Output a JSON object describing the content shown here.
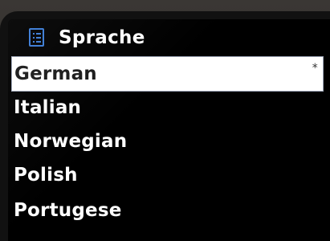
{
  "header": {
    "icon": "list-menu-icon",
    "title": "Sprache"
  },
  "languages": {
    "items": [
      {
        "label": "German",
        "selected": true,
        "marker": "*"
      },
      {
        "label": "Italian",
        "selected": false
      },
      {
        "label": "Norwegian",
        "selected": false
      },
      {
        "label": "Polish",
        "selected": false
      },
      {
        "label": "Portugese",
        "selected": false
      }
    ]
  },
  "colors": {
    "accent": "#3a7bd5",
    "highlight_bg": "#ffffff",
    "text": "#ffffff",
    "background": "#000000"
  }
}
